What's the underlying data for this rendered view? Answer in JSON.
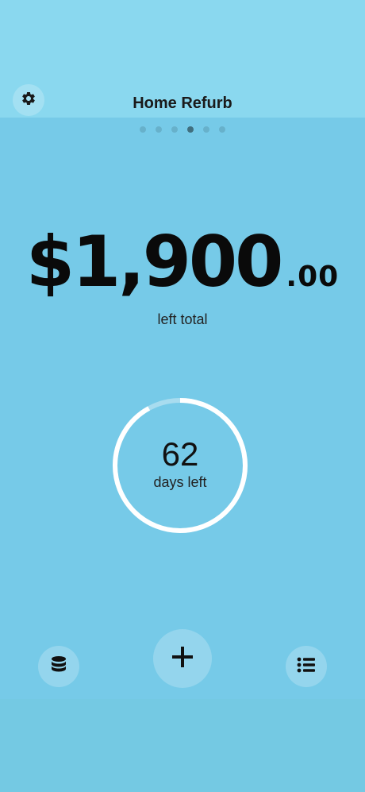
{
  "header": {
    "title": "Home Refurb",
    "settings_icon": "gear-icon",
    "page_count": 6,
    "active_page": 4
  },
  "summary": {
    "amount_main": "$1,900",
    "amount_cents": ".00",
    "amount_label": "left total"
  },
  "countdown": {
    "days": "62",
    "label": "days left",
    "progress_fraction": 0.92,
    "ring_color": "#ffffff",
    "track_color": "#a8dcef"
  },
  "toolbar": {
    "left_icon": "database-icon",
    "center_icon": "plus-icon",
    "right_icon": "list-icon"
  },
  "colors": {
    "background": "#76cae8",
    "top_band": "#8ad8ef"
  }
}
